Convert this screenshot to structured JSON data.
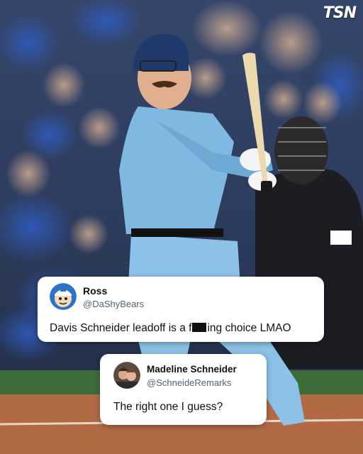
{
  "brand": {
    "logo_text": "TSN"
  },
  "tweets": [
    {
      "display_name": "Ross",
      "handle": "@DaShyBears",
      "text_before": "Davis Schneider leadoff is a f",
      "text_after": "ing choice LMAO",
      "avatar_icon": "cartoon-avatar-icon"
    },
    {
      "display_name": "Madeline Schneider",
      "handle": "@SchneideRemarks",
      "text": "The right one I guess?",
      "avatar_icon": "photo-avatar-icon"
    }
  ],
  "colors": {
    "jersey": "#7fb8e0",
    "card_bg": "#ffffff",
    "handle": "#536471"
  }
}
